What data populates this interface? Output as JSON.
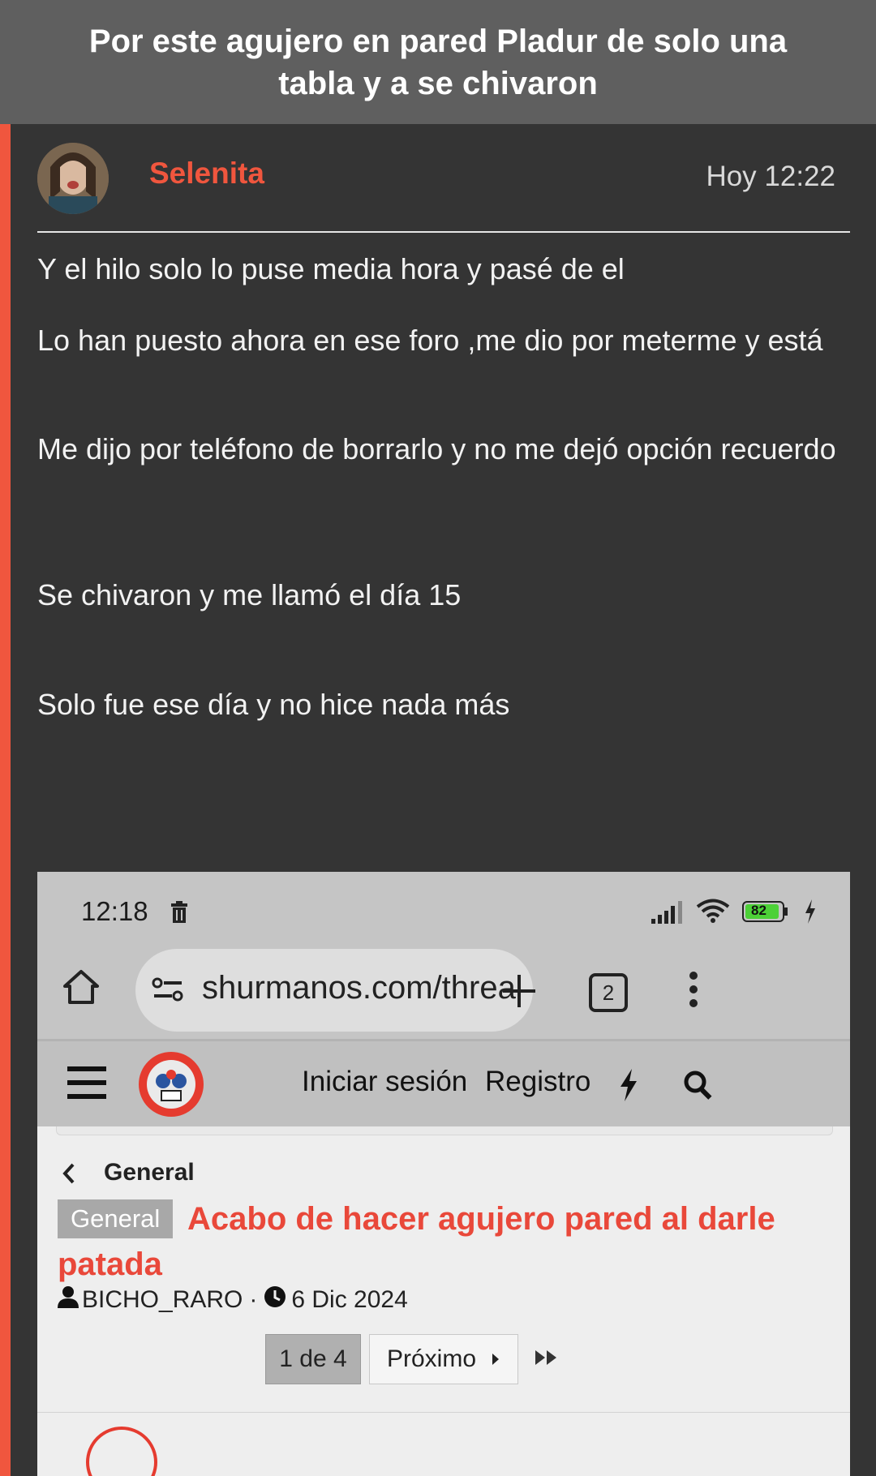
{
  "header": {
    "title": "Por este agujero en pared Pladur de solo una tabla y a se chivaron"
  },
  "post": {
    "username": "Selenita",
    "time": "Hoy 12:22",
    "paragraphs": [
      "Y el hilo solo lo puse media hora y pasé de el",
      "Lo han puesto ahora en ese foro ,me dio por meterme y está",
      "Me dijo por teléfono de borrarlo y no me dejó opción recuerdo",
      "Se chivaron y me llamó el día 15",
      "Solo fue ese día y no hice nada más"
    ]
  },
  "screenshot": {
    "status": {
      "time": "12:18",
      "battery": "82"
    },
    "browser": {
      "url": "shurmanos.com/threa",
      "tabs_count": "2"
    },
    "nav": {
      "login": "Iniciar sesión",
      "register": "Registro"
    },
    "breadcrumb": "General",
    "thread": {
      "tag": "General",
      "title": "Acabo de hacer agujero pared al darle patada",
      "author": "BICHO_RARO",
      "separator": "·",
      "date": "6 Dic 2024"
    },
    "pagination": {
      "current": "1 de 4",
      "next": "Próximo"
    }
  },
  "colors": {
    "accent": "#f0563e",
    "title_red": "#e9483a",
    "battery_green": "#4cd137"
  }
}
